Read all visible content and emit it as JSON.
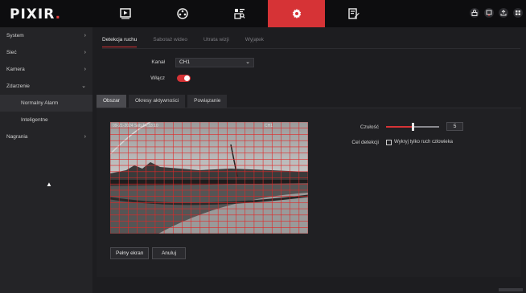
{
  "logo": "PIXIR.",
  "topnav": [
    {
      "icon": "playback-icon"
    },
    {
      "icon": "camera-icon"
    },
    {
      "icon": "search-file-icon"
    },
    {
      "icon": "gear-icon",
      "active": true
    },
    {
      "icon": "edit-icon"
    }
  ],
  "top_right_icons": [
    "lock-icon",
    "screen-lock-icon",
    "upload-icon",
    "grid-icon"
  ],
  "sidebar": {
    "items": [
      {
        "label": "System",
        "chevron": "›"
      },
      {
        "label": "Sieć",
        "chevron": "›"
      },
      {
        "label": "Kamera",
        "chevron": "›"
      },
      {
        "label": "Zdarzenie",
        "chevron": "⌄"
      },
      {
        "label": "Normalny Alarm",
        "sub": true,
        "selected": true
      },
      {
        "label": "Inteligentne",
        "sub": true
      },
      {
        "label": "Nagrania",
        "chevron": "›"
      }
    ]
  },
  "tabs": [
    {
      "label": "Detekcja ruchu",
      "active": true
    },
    {
      "label": "Sabotaż wideo"
    },
    {
      "label": "Utrata wizji"
    },
    {
      "label": "Wyjątek"
    }
  ],
  "channel": {
    "label": "Kanał",
    "value": "CH1"
  },
  "enable": {
    "label": "Włącz",
    "value": "on"
  },
  "subtabs": [
    {
      "label": "Obszar",
      "active": true
    },
    {
      "label": "Okresy aktywności"
    },
    {
      "label": "Powiązanie"
    }
  ],
  "video": {
    "osd_left": "09-21-2024 Sob 14:33:10",
    "osd_right": "CH1"
  },
  "sensitivity": {
    "label": "Czułość",
    "value": "5",
    "fraction": 0.5
  },
  "detect_target": {
    "label": "Cel detekcji",
    "checkbox_label": "Wykryj tylko ruch człowieka",
    "checked": false
  },
  "buttons": {
    "fullscreen": "Pełny ekran",
    "cancel": "Anuluj"
  },
  "colors": {
    "accent": "#d63336",
    "grid": "#e02828"
  }
}
